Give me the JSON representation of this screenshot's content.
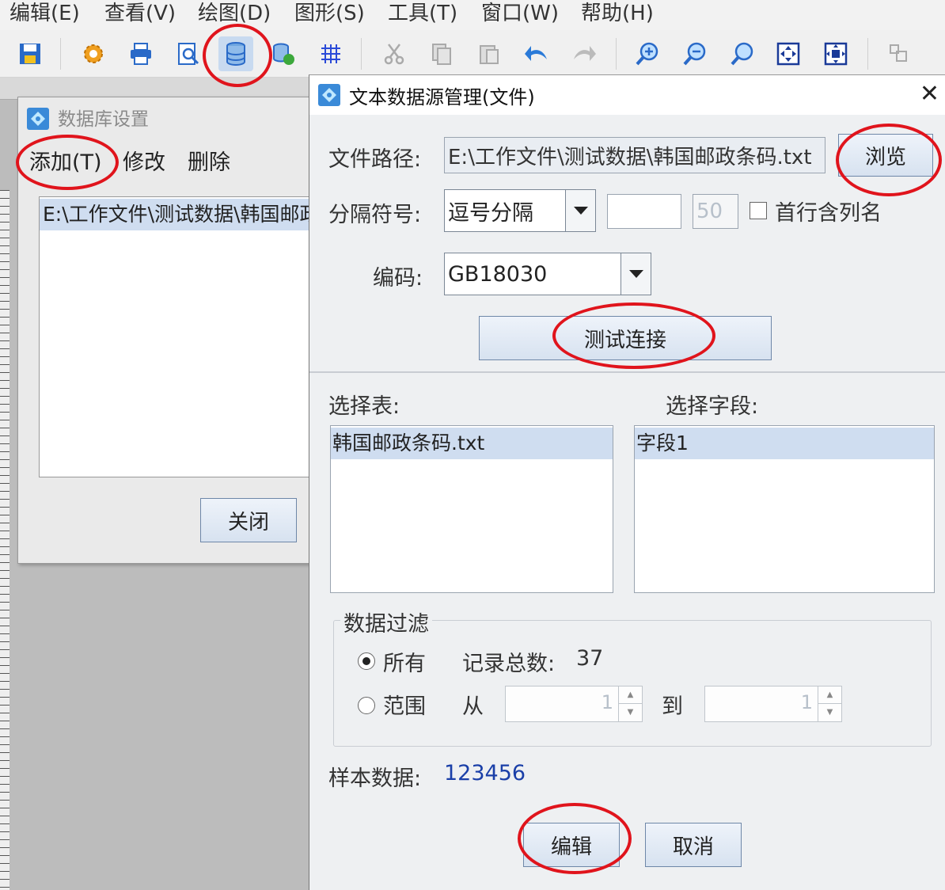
{
  "menu": [
    "编辑(E)",
    "查看(V)",
    "绘图(D)",
    "图形(S)",
    "工具(T)",
    "窗口(W)",
    "帮助(H)"
  ],
  "toolbar_icons": [
    "save-icon",
    "gear-icon",
    "print-icon",
    "preview-icon",
    "database-icon",
    "database-link-icon",
    "grid-icon",
    "cut-icon",
    "copy-icon",
    "paste-icon",
    "undo-icon",
    "redo-icon",
    "zoom-in-icon",
    "zoom-out-icon",
    "zoom-icon",
    "fit-page-icon",
    "fit-width-icon",
    "align-icon"
  ],
  "db_dialog": {
    "title": "数据库设置",
    "menu_add": "添加(T)",
    "menu_edit": "修改",
    "menu_delete": "删除",
    "list_items": [
      "E:\\工作文件\\测试数据\\韩国邮政条码.txt"
    ],
    "close_label": "关闭"
  },
  "ds_dialog": {
    "title": "文本数据源管理(文件)",
    "close_glyph": "✕",
    "file_path_label": "文件路径:",
    "file_path_value": "E:\\工作文件\\测试数据\\韩国邮政条码.txt",
    "browse_label": "浏览",
    "separator_label": "分隔符号:",
    "separator_value": "逗号分隔",
    "custom_separator_value": "",
    "length_value": "50",
    "first_row_header_label": "首行含列名",
    "encoding_label": "编码:",
    "encoding_value": "GB18030",
    "test_connection_label": "测试连接",
    "select_table_label": "选择表:",
    "select_field_label": "选择字段:",
    "tables": [
      "韩国邮政条码.txt"
    ],
    "fields": [
      "字段1"
    ],
    "filter_title": "数据过滤",
    "filter_all_label": "所有",
    "record_count_label": "记录总数:",
    "record_count_value": "37",
    "filter_range_label": "范围",
    "range_from_label": "从",
    "range_from_value": "1",
    "range_to_label": "到",
    "range_to_value": "1",
    "sample_label": "样本数据:",
    "sample_value": "123456",
    "edit_label": "编辑",
    "cancel_label": "取消"
  },
  "colors": {
    "annotation_red": "#e0141c",
    "selection_blue": "#cfddf0",
    "sample_text_blue": "#1a3fa8"
  }
}
